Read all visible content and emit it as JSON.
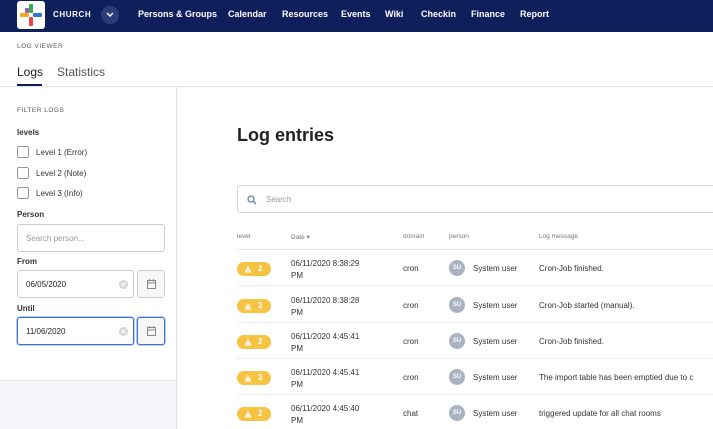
{
  "colors": {
    "nav_bg": "#0e1f5c",
    "badge_warning": "#f6c343",
    "focus": "#3d6fd6"
  },
  "brand": {
    "name": "CHURCH"
  },
  "nav": [
    "Persons & Groups",
    "Calendar",
    "Resources",
    "Events",
    "Wiki",
    "Checkin",
    "Finance",
    "Report"
  ],
  "page": {
    "eyebrow": "LOG VIEWER",
    "tabs": [
      "Logs",
      "Statistics"
    ],
    "active_tab": "Logs"
  },
  "filters": {
    "title": "FILTER LOGS",
    "levels_label": "levels",
    "levels": [
      "Level 1 (Error)",
      "Level 2 (Note)",
      "Level 3 (Info)"
    ],
    "person_label": "Person",
    "person_placeholder": "Search person...",
    "from_label": "From",
    "from_value": "06/05/2020",
    "until_label": "Until",
    "until_value": "11/06/2020"
  },
  "main": {
    "title": "Log entries",
    "search_placeholder": "Search",
    "columns": [
      "level",
      "Date",
      "domain",
      "person",
      "Log message"
    ],
    "sort_column": "Date",
    "rows": [
      {
        "level": "2",
        "date": "06/11/2020 8:38:29 PM",
        "domain": "cron",
        "avatar": "SU",
        "person": "System user",
        "message": "Cron-Job finished."
      },
      {
        "level": "2",
        "date": "06/11/2020 8:38:28 PM",
        "domain": "cron",
        "avatar": "SU",
        "person": "System user",
        "message": "Cron-Job started (manual)."
      },
      {
        "level": "2",
        "date": "06/11/2020 4:45:41 PM",
        "domain": "cron",
        "avatar": "SU",
        "person": "System user",
        "message": "Cron-Job finished."
      },
      {
        "level": "2",
        "date": "06/11/2020 4:45:41 PM",
        "domain": "cron",
        "avatar": "SU",
        "person": "System user",
        "message": "The import table has been emptied due to c"
      },
      {
        "level": "2",
        "date": "06/11/2020 4:45:40 PM",
        "domain": "chat",
        "avatar": "SU",
        "person": "System user",
        "message": "triggered update for all chat rooms"
      }
    ]
  }
}
